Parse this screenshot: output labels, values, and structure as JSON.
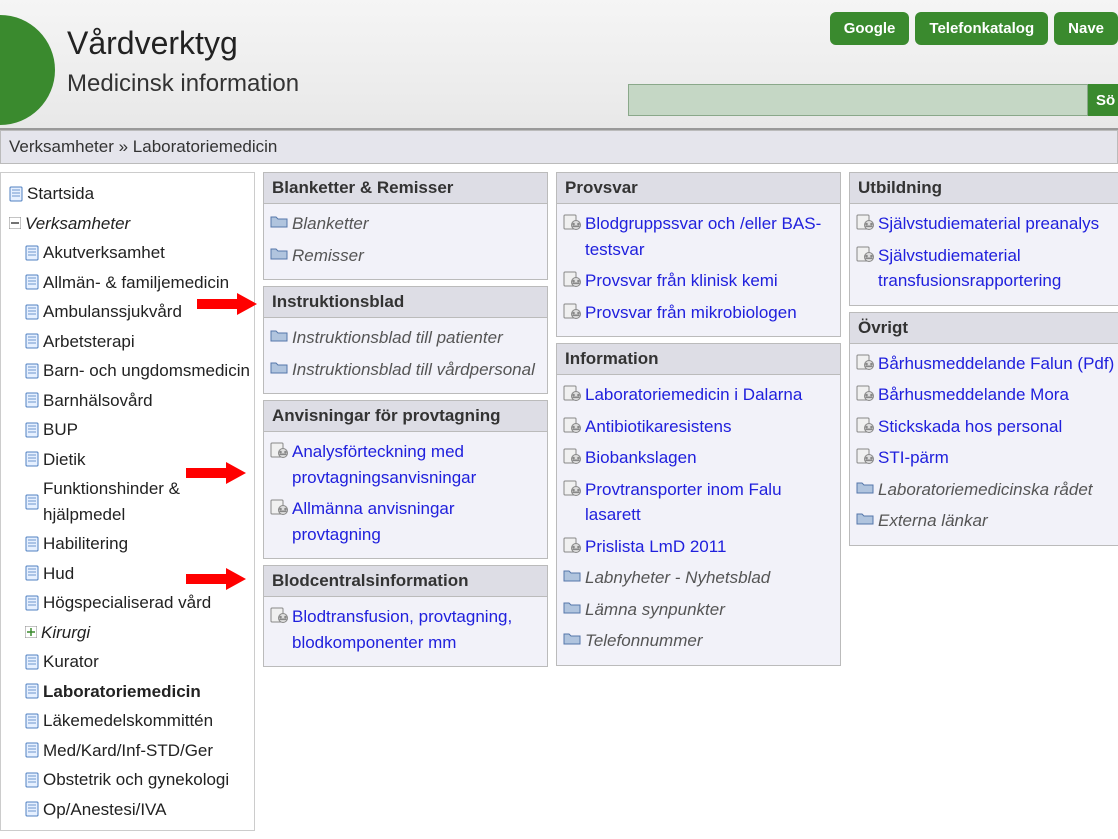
{
  "header": {
    "title": "Vårdverktyg",
    "subtitle": "Medicinsk information",
    "top_buttons": [
      "Google",
      "Telefonkatalog",
      "Nave"
    ],
    "search_button": "Sö"
  },
  "breadcrumb": {
    "part1": "Verksamheter",
    "sep": " » ",
    "part2": "Laboratoriemedicin"
  },
  "sidebar": {
    "items": [
      {
        "label": "Startsida",
        "icon": "page",
        "indent": false
      },
      {
        "label": "Verksamheter",
        "icon": "minus",
        "indent": false,
        "italic": true
      },
      {
        "label": "Akutverksamhet",
        "icon": "page",
        "indent": true
      },
      {
        "label": "Allmän- & familjemedicin",
        "icon": "page",
        "indent": true
      },
      {
        "label": "Ambulanssjukvård",
        "icon": "page",
        "indent": true
      },
      {
        "label": "Arbetsterapi",
        "icon": "page",
        "indent": true
      },
      {
        "label": "Barn- och ungdomsmedicin",
        "icon": "page",
        "indent": true
      },
      {
        "label": "Barnhälsovård",
        "icon": "page",
        "indent": true
      },
      {
        "label": "BUP",
        "icon": "page",
        "indent": true
      },
      {
        "label": "Dietik",
        "icon": "page",
        "indent": true
      },
      {
        "label": "Funktionshinder & hjälpmedel",
        "icon": "page",
        "indent": true
      },
      {
        "label": "Habilitering",
        "icon": "page",
        "indent": true
      },
      {
        "label": "Hud",
        "icon": "page",
        "indent": true
      },
      {
        "label": "Högspecialiserad vård",
        "icon": "page",
        "indent": true
      },
      {
        "label": "Kirurgi",
        "icon": "plus",
        "indent": true,
        "italic": true
      },
      {
        "label": "Kurator",
        "icon": "page",
        "indent": true
      },
      {
        "label": "Laboratoriemedicin",
        "icon": "page",
        "indent": true,
        "bold": true
      },
      {
        "label": "Läkemedelskommittén",
        "icon": "page",
        "indent": true
      },
      {
        "label": "Med/Kard/Inf-STD/Ger",
        "icon": "page",
        "indent": true
      },
      {
        "label": "Obstetrik och gynekologi",
        "icon": "page",
        "indent": true
      },
      {
        "label": "Op/Anestesi/IVA",
        "icon": "page",
        "indent": true
      }
    ]
  },
  "columns": [
    [
      {
        "header": "Blanketter & Remisser",
        "items": [
          {
            "type": "folder",
            "label": "Blanketter"
          },
          {
            "type": "folder",
            "label": "Remisser"
          }
        ]
      },
      {
        "header": "Instruktionsblad",
        "items": [
          {
            "type": "folder",
            "label": "Instruktionsblad till patienter"
          },
          {
            "type": "folder",
            "label": "Instruktionsblad till vårdpersonal"
          }
        ]
      },
      {
        "header": "Anvisningar för provtagning",
        "items": [
          {
            "type": "doc",
            "label": "Analysförteckning med provtagningsanvisningar"
          },
          {
            "type": "doc",
            "label": "Allmänna anvisningar provtagning"
          }
        ]
      },
      {
        "header": "Blodcentralsinformation",
        "items": [
          {
            "type": "doc",
            "label": "Blodtransfusion, provtagning, blodkomponenter mm"
          }
        ]
      }
    ],
    [
      {
        "header": "Provsvar",
        "items": [
          {
            "type": "doc",
            "label": "Blodgruppssvar och /eller BAS-testsvar"
          },
          {
            "type": "doc",
            "label": "Provsvar från klinisk kemi"
          },
          {
            "type": "doc",
            "label": "Provsvar från mikrobiologen"
          }
        ]
      },
      {
        "header": "Information",
        "items": [
          {
            "type": "doc",
            "label": "Laboratoriemedicin i Dalarna"
          },
          {
            "type": "doc",
            "label": "Antibiotikaresistens"
          },
          {
            "type": "doc",
            "label": "Biobankslagen"
          },
          {
            "type": "doc",
            "label": "Provtransporter inom Falu lasarett"
          },
          {
            "type": "doc",
            "label": "Prislista LmD 2011"
          },
          {
            "type": "folder",
            "label": "Labnyheter - Nyhetsblad"
          },
          {
            "type": "folder",
            "label": "Lämna synpunkter"
          },
          {
            "type": "folder",
            "label": "Telefonnummer"
          }
        ]
      }
    ],
    [
      {
        "header": "Utbildning",
        "items": [
          {
            "type": "doc",
            "label": "Självstudiematerial preanalys"
          },
          {
            "type": "doc",
            "label": "Självstudiematerial transfusionsrapportering"
          }
        ]
      },
      {
        "header": "Övrigt",
        "items": [
          {
            "type": "doc",
            "label": "Bårhusmeddelande Falun (Pdf)"
          },
          {
            "type": "doc",
            "label": "Bårhusmeddelande Mora"
          },
          {
            "type": "doc",
            "label": "Stickskada hos personal"
          },
          {
            "type": "doc",
            "label": "STI-pärm"
          },
          {
            "type": "folder",
            "label": "Laboratoriemedicinska rådet"
          },
          {
            "type": "folder",
            "label": "Externa länkar"
          }
        ]
      }
    ]
  ]
}
